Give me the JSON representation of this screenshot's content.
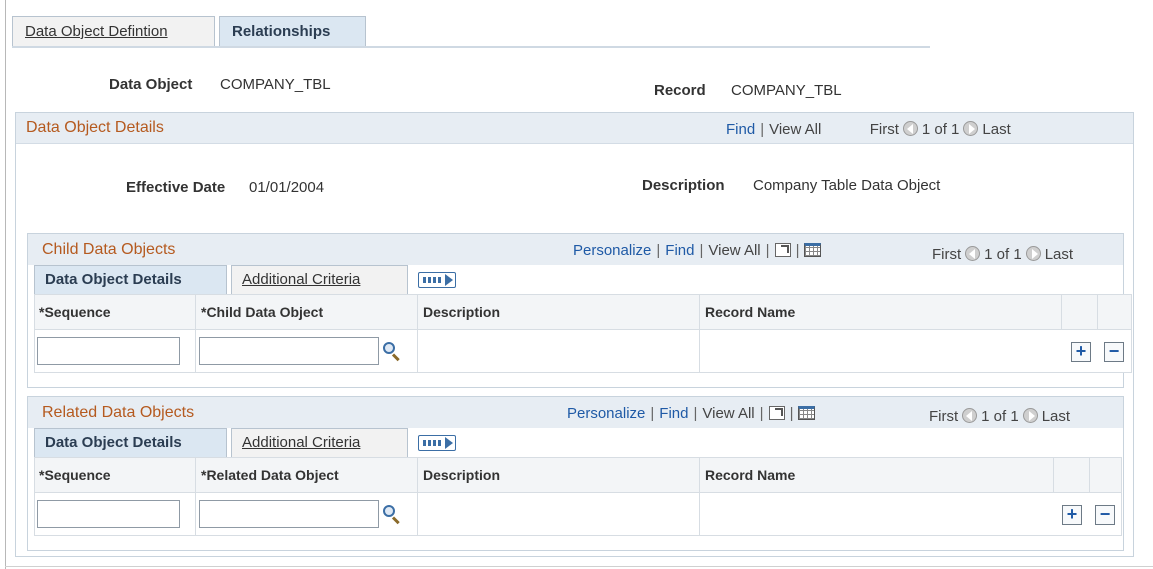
{
  "tabs": [
    {
      "label": "Data Object Defintion",
      "accesskey": "D",
      "rest": "ata Object Defintion",
      "active": false
    },
    {
      "label": "Relationships",
      "active": true
    }
  ],
  "header": {
    "data_object_label": "Data Object",
    "data_object_value": "COMPANY_TBL",
    "record_label": "Record",
    "record_value": "COMPANY_TBL"
  },
  "details": {
    "title": "Data Object Details",
    "find": "Find",
    "sep": "|",
    "view_all": "View All",
    "first": "First",
    "count": "1 of 1",
    "last": "Last",
    "effective_date_label": "Effective Date",
    "effective_date_value": "01/01/2004",
    "description_label": "Description",
    "description_value": "Company Table Data Object"
  },
  "child": {
    "title": "Child Data Objects",
    "personalize": "Personalize",
    "find": "Find",
    "view_all": "View All",
    "first": "First",
    "count": "1 of 1",
    "last": "Last",
    "tab_details": "Data Object Details",
    "tab_criteria_first": "A",
    "tab_criteria_rest": "dditional Criteria",
    "col_sequence": "*Sequence",
    "col_object": "*Child Data Object",
    "col_description": "Description",
    "col_record": "Record Name",
    "sequence_value": "",
    "object_value": ""
  },
  "related": {
    "title": "Related Data Objects",
    "personalize": "Personalize",
    "find": "Find",
    "view_all": "View All",
    "first": "First",
    "count": "1 of 1",
    "last": "Last",
    "tab_details": "Data Object Details",
    "tab_criteria_first": "A",
    "tab_criteria_rest": "dditional Criteria",
    "col_sequence": "*Sequence",
    "col_object": "*Related Data Object",
    "col_description": "Description",
    "col_record": "Record Name",
    "sequence_value": "",
    "object_value": ""
  },
  "buttons": {
    "add": "+",
    "remove": "−"
  },
  "icons": {
    "prev": "circle-left-arrow-icon",
    "next": "circle-right-arrow-icon",
    "zoom": "new-window-icon",
    "grid": "spreadsheet-download-icon",
    "lookup": "magnifier-lookup-icon",
    "expand": "show-all-columns-icon"
  },
  "colors": {
    "title": "#b55a1f",
    "link": "#1f5aa6",
    "header_bg": "#e7edf3"
  }
}
